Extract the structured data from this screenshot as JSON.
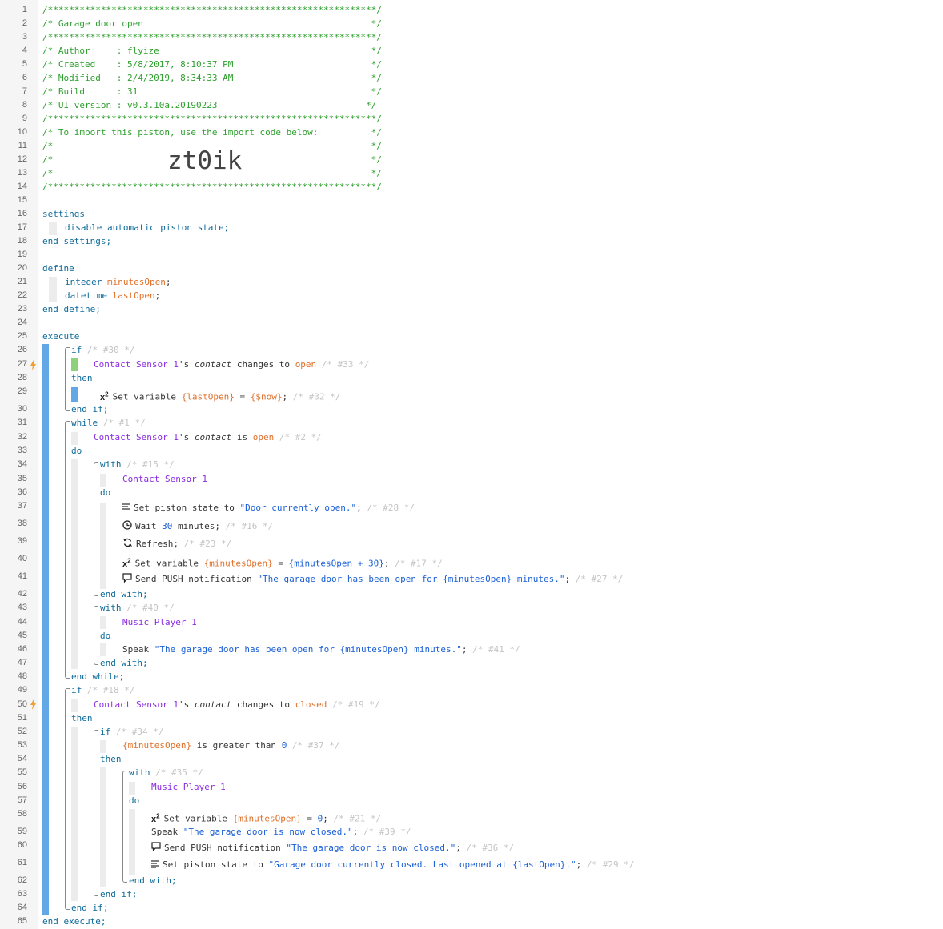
{
  "line_numbers": [
    "1",
    "2",
    "3",
    "4",
    "5",
    "6",
    "7",
    "8",
    "9",
    "10",
    "11",
    "12",
    "13",
    "14",
    "15",
    "16",
    "17",
    "18",
    "19",
    "20",
    "21",
    "22",
    "23",
    "24",
    "25",
    "26",
    "27",
    "28",
    "29",
    "30",
    "31",
    "32",
    "33",
    "34",
    "35",
    "36",
    "37",
    "38",
    "39",
    "40",
    "41",
    "42",
    "43",
    "44",
    "45",
    "46",
    "47",
    "48",
    "49",
    "50",
    "51",
    "52",
    "53",
    "54",
    "55",
    "56",
    "57",
    "58",
    "59",
    "60",
    "61",
    "62",
    "63",
    "64",
    "65"
  ],
  "header": {
    "stars": "/**************************************************************/",
    "title": "/* Garage door open                                           */",
    "author": "/* Author     : flyize                                        */",
    "created": "/* Created    : 5/8/2017, 8:10:37 PM                          */",
    "modified": "/* Modified   : 2/4/2019, 8:34:33 AM                          */",
    "build": "/* Build      : 31                                            */",
    "ui_version": "/* UI version : v0.3.10a.20190223                            */",
    "import_note": "/* To import this piston, use the import code below:          */",
    "blank": "/*                                                            */",
    "import_prefix": "/*              ",
    "import_code": "zt0ik",
    "import_suffix": "                      */"
  },
  "kw": {
    "settings": "settings",
    "disable": "disable automatic piston state;",
    "end_settings": "end settings;",
    "define": "define",
    "integer": "integer",
    "datetime": "datetime",
    "end_define": "end define;",
    "execute": "execute",
    "if": "if",
    "then": "then",
    "end_if": "end if;",
    "while": "while",
    "do": "do",
    "with": "with",
    "end_with": "end with;",
    "end_while": "end while;",
    "end_execute": "end execute;",
    "semicolon": ";",
    "possessive": "'s",
    "changes_to": "changes to",
    "is": "is",
    "is_greater_than": "is greater than",
    "set_variable": "Set variable",
    "set_piston_state": "Set piston state to",
    "wait": "Wait",
    "minutes": "minutes;",
    "refresh": "Refresh;",
    "send_push": "Send PUSH notification",
    "speak": "Speak",
    "eq": "=",
    "tail": ";"
  },
  "vars": {
    "minutesOpen": "minutesOpen",
    "lastOpen": "lastOpen",
    "minutesOpen_ref": "{minutesOpen}",
    "lastOpen_ref": "{lastOpen}",
    "now_ref": "{$now}",
    "expr_plus": "{minutesOpen + 30}"
  },
  "devices": {
    "contact_sensor": "Contact Sensor 1",
    "music_player": "Music Player 1"
  },
  "attrs": {
    "contact": "contact",
    "open": "open",
    "closed": "closed"
  },
  "values": {
    "thirty": "30",
    "zero": "0"
  },
  "strings": {
    "door_open_state": "\"Door currently open.\"",
    "push_open": "\"The garage door has been open for {minutesOpen} minutes.\"",
    "speak_open": "\"The garage door has been open for {minutesOpen} minutes.\"",
    "speak_closed": "\"The garage door is now closed.\"",
    "push_closed": "\"The garage door is now closed.\"",
    "closed_state": "\"Garage door currently closed. Last opened at {lastOpen}.\""
  },
  "ids": {
    "s30": "/* #30 */",
    "s33": "/* #33 */",
    "s32": "/* #32 */",
    "s1": "/* #1 */",
    "s2": "/* #2 */",
    "s15": "/* #15 */",
    "s28": "/* #28 */",
    "s16": "/* #16 */",
    "s23": "/* #23 */",
    "s17": "/* #17 */",
    "s27": "/* #27 */",
    "s40": "/* #40 */",
    "s41": "/* #41 */",
    "s18": "/* #18 */",
    "s19": "/* #19 */",
    "s34": "/* #34 */",
    "s37": "/* #37 */",
    "s35": "/* #35 */",
    "s21": "/* #21 */",
    "s39": "/* #39 */",
    "s36": "/* #36 */",
    "s29": "/* #29 */"
  },
  "colors": {
    "comment": "#2e9f2e",
    "keyword": "#0d6a9a",
    "device": "#8a2be2",
    "variable": "#e0702a",
    "string": "#1a5fd6",
    "trigger_bolt": "#f0a030",
    "exec_bar": "#62a8e6"
  },
  "icons": {
    "trigger": "lightning-bolt-icon",
    "variable": "superscript-x2-icon",
    "state": "text-align-icon",
    "wait": "clock-icon",
    "refresh": "refresh-icon",
    "push": "speech-bubble-icon"
  }
}
